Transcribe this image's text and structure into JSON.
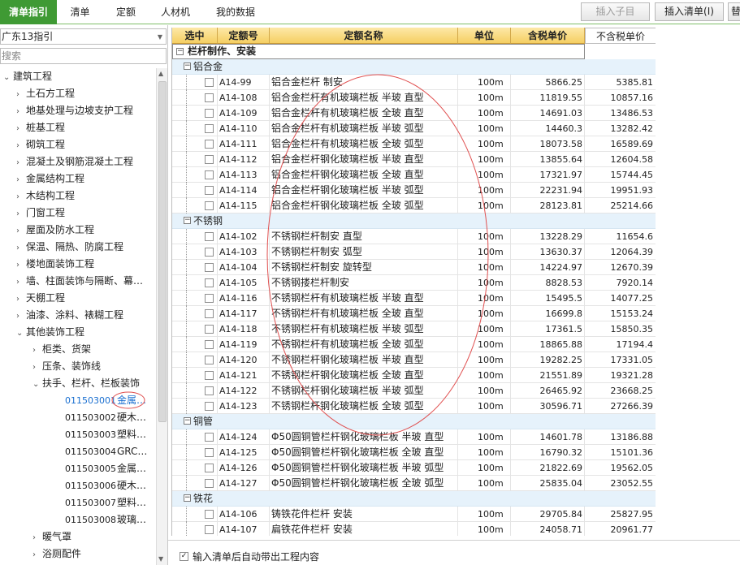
{
  "tabs": [
    {
      "label": "清单指引",
      "active": true
    },
    {
      "label": "清单",
      "active": false
    },
    {
      "label": "定额",
      "active": false
    },
    {
      "label": "人材机",
      "active": false
    },
    {
      "label": "我的数据",
      "active": false
    }
  ],
  "toolbar": {
    "insert_child_label": "插入子目",
    "insert_list_label": "插入清单(I)",
    "extra_label": "替"
  },
  "left": {
    "combo_value": "广东13指引",
    "search_placeholder": "搜索",
    "tree": [
      {
        "label": "建筑工程",
        "expanded": true,
        "level": 0
      },
      {
        "label": "土石方工程",
        "level": 1
      },
      {
        "label": "地基处理与边坡支护工程",
        "level": 1
      },
      {
        "label": "桩基工程",
        "level": 1
      },
      {
        "label": "砌筑工程",
        "level": 1
      },
      {
        "label": "混凝土及钢筋混凝土工程",
        "level": 1
      },
      {
        "label": "金属结构工程",
        "level": 1
      },
      {
        "label": "木结构工程",
        "level": 1
      },
      {
        "label": "门窗工程",
        "level": 1
      },
      {
        "label": "屋面及防水工程",
        "level": 1
      },
      {
        "label": "保温、隔热、防腐工程",
        "level": 1
      },
      {
        "label": "楼地面装饰工程",
        "level": 1
      },
      {
        "label": "墙、柱面装饰与隔断、幕…",
        "level": 1
      },
      {
        "label": "天棚工程",
        "level": 1
      },
      {
        "label": "油漆、涂料、裱糊工程",
        "level": 1
      },
      {
        "label": "其他装饰工程",
        "expanded": true,
        "level": 1
      },
      {
        "label": "柜类、货架",
        "level": 2
      },
      {
        "label": "压条、装饰线",
        "level": 2
      },
      {
        "label": "扶手、栏杆、栏板装饰",
        "expanded": true,
        "level": 2
      },
      {
        "code": "011503001",
        "label": "金属…",
        "level": 3,
        "selected": true
      },
      {
        "code": "011503002",
        "label": "硬木…",
        "level": 3
      },
      {
        "code": "011503003",
        "label": "塑料…",
        "level": 3
      },
      {
        "code": "011503004",
        "label": "GRC…",
        "level": 3
      },
      {
        "code": "011503005",
        "label": "金属…",
        "level": 3
      },
      {
        "code": "011503006",
        "label": "硬木…",
        "level": 3
      },
      {
        "code": "011503007",
        "label": "塑料…",
        "level": 3
      },
      {
        "code": "011503008",
        "label": "玻璃…",
        "level": 3
      },
      {
        "label": "暖气罩",
        "level": 2
      },
      {
        "label": "浴厕配件",
        "level": 2
      }
    ]
  },
  "grid": {
    "headers": {
      "select": "选中",
      "code": "定额号",
      "name": "定额名称",
      "unit": "单位",
      "tax_price": "含税单价",
      "notax_price": "不含税单价"
    },
    "root_group": "栏杆制作、安装",
    "groups": [
      {
        "name": "铝合金",
        "rows": [
          {
            "code": "A14-99",
            "name": "铝合金栏杆 制安",
            "unit": "100m",
            "tax": "5866.25",
            "notax": "5385.81"
          },
          {
            "code": "A14-108",
            "name": "铝合金栏杆有机玻璃栏板 半玻 直型",
            "unit": "100m",
            "tax": "11819.55",
            "notax": "10857.16"
          },
          {
            "code": "A14-109",
            "name": "铝合金栏杆有机玻璃栏板 全玻 直型",
            "unit": "100m",
            "tax": "14691.03",
            "notax": "13486.53"
          },
          {
            "code": "A14-110",
            "name": "铝合金栏杆有机玻璃栏板 半玻 弧型",
            "unit": "100m",
            "tax": "14460.3",
            "notax": "13282.42"
          },
          {
            "code": "A14-111",
            "name": "铝合金栏杆有机玻璃栏板 全玻 弧型",
            "unit": "100m",
            "tax": "18073.58",
            "notax": "16589.69"
          },
          {
            "code": "A14-112",
            "name": "铝合金栏杆钢化玻璃栏板 半玻 直型",
            "unit": "100m",
            "tax": "13855.64",
            "notax": "12604.58"
          },
          {
            "code": "A14-113",
            "name": "铝合金栏杆钢化玻璃栏板 全玻 直型",
            "unit": "100m",
            "tax": "17321.97",
            "notax": "15744.45"
          },
          {
            "code": "A14-114",
            "name": "铝合金栏杆钢化玻璃栏板 半玻 弧型",
            "unit": "100m",
            "tax": "22231.94",
            "notax": "19951.93"
          },
          {
            "code": "A14-115",
            "name": "铝合金栏杆钢化玻璃栏板 全玻 弧型",
            "unit": "100m",
            "tax": "28123.81",
            "notax": "25214.66"
          }
        ]
      },
      {
        "name": "不锈钢",
        "rows": [
          {
            "code": "A14-102",
            "name": "不锈钢栏杆制安 直型",
            "unit": "100m",
            "tax": "13228.29",
            "notax": "11654.6"
          },
          {
            "code": "A14-103",
            "name": "不锈钢栏杆制安 弧型",
            "unit": "100m",
            "tax": "13630.37",
            "notax": "12064.39"
          },
          {
            "code": "A14-104",
            "name": "不锈钢栏杆制安 旋转型",
            "unit": "100m",
            "tax": "14224.97",
            "notax": "12670.39"
          },
          {
            "code": "A14-105",
            "name": "不锈钢搂栏杆制安",
            "unit": "100m",
            "tax": "8828.53",
            "notax": "7920.14"
          },
          {
            "code": "A14-116",
            "name": "不锈钢栏杆有机玻璃栏板 半玻 直型",
            "unit": "100m",
            "tax": "15495.5",
            "notax": "14077.25"
          },
          {
            "code": "A14-117",
            "name": "不锈钢栏杆有机玻璃栏板 全玻 直型",
            "unit": "100m",
            "tax": "16699.8",
            "notax": "15153.24"
          },
          {
            "code": "A14-118",
            "name": "不锈钢栏杆有机玻璃栏板 半玻 弧型",
            "unit": "100m",
            "tax": "17361.5",
            "notax": "15850.35"
          },
          {
            "code": "A14-119",
            "name": "不锈钢栏杆有机玻璃栏板 全玻 弧型",
            "unit": "100m",
            "tax": "18865.88",
            "notax": "17194.4"
          },
          {
            "code": "A14-120",
            "name": "不锈钢栏杆钢化玻璃栏板 半玻 直型",
            "unit": "100m",
            "tax": "19282.25",
            "notax": "17331.05"
          },
          {
            "code": "A14-121",
            "name": "不锈钢栏杆钢化玻璃栏板 全玻 直型",
            "unit": "100m",
            "tax": "21551.89",
            "notax": "19321.28"
          },
          {
            "code": "A14-122",
            "name": "不锈钢栏杆钢化玻璃栏板 半玻 弧型",
            "unit": "100m",
            "tax": "26465.92",
            "notax": "23668.25"
          },
          {
            "code": "A14-123",
            "name": "不锈钢栏杆钢化玻璃栏板 全玻 弧型",
            "unit": "100m",
            "tax": "30596.71",
            "notax": "27266.39"
          }
        ]
      },
      {
        "name": "铜管",
        "rows": [
          {
            "code": "A14-124",
            "name": "Φ50圆铜管栏杆钢化玻璃栏板 半玻 直型",
            "unit": "100m",
            "tax": "14601.78",
            "notax": "13186.88"
          },
          {
            "code": "A14-125",
            "name": "Φ50圆铜管栏杆钢化玻璃栏板 全玻 直型",
            "unit": "100m",
            "tax": "16790.32",
            "notax": "15101.36"
          },
          {
            "code": "A14-126",
            "name": "Φ50圆铜管栏杆钢化玻璃栏板 半玻 弧型",
            "unit": "100m",
            "tax": "21822.69",
            "notax": "19562.05"
          },
          {
            "code": "A14-127",
            "name": "Φ50圆铜管栏杆钢化玻璃栏板 全玻 弧型",
            "unit": "100m",
            "tax": "25835.04",
            "notax": "23052.55"
          }
        ]
      },
      {
        "name": "铁花",
        "rows": [
          {
            "code": "A14-106",
            "name": "铸铁花件栏杆 安装",
            "unit": "100m",
            "tax": "29705.84",
            "notax": "25827.95"
          },
          {
            "code": "A14-107",
            "name": "扁铁花件栏杆 安装",
            "unit": "100m",
            "tax": "24058.71",
            "notax": "20961.77"
          }
        ]
      }
    ]
  },
  "bottom": {
    "auto_label": "输入清单后自动带出工程内容",
    "auto_checked": true
  },
  "colors": {
    "tab_active": "#3f9a34",
    "header": "#f5cf63",
    "group_bg": "#e6f2fb",
    "annotation": "#e05050"
  }
}
